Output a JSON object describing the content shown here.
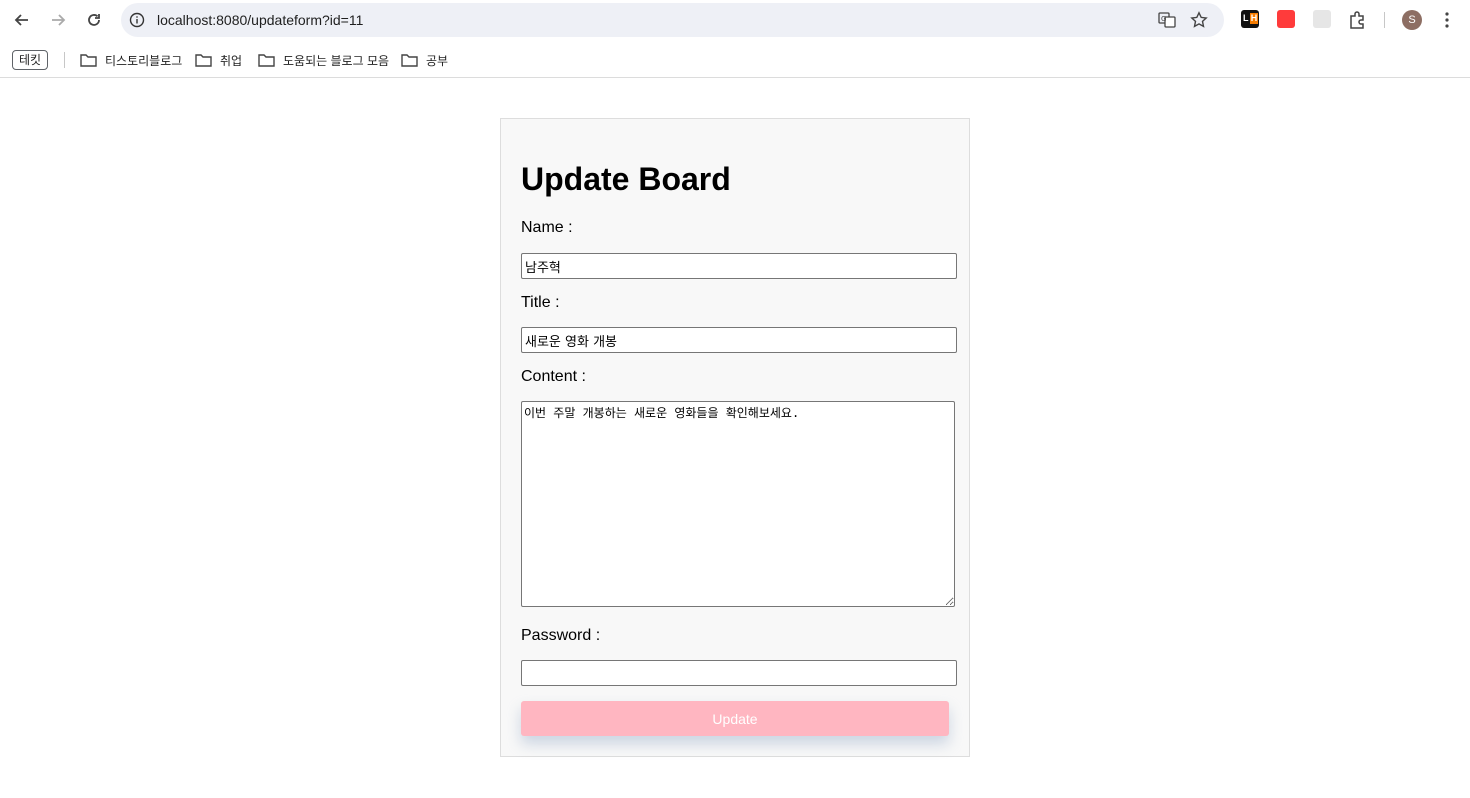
{
  "browser": {
    "url": "localhost:8080/updateform?id=11",
    "profile_initial": "S",
    "bookmarks": [
      {
        "label": "테킷"
      },
      {
        "label": "티스토리블로그"
      },
      {
        "label": "취업"
      },
      {
        "label": "도움되는 블로그 모음"
      },
      {
        "label": "공부"
      }
    ]
  },
  "form": {
    "title": "Update Board",
    "name_label": "Name :",
    "name_value": "남주혁",
    "title_label": "Title :",
    "title_value": "새로운 영화 개봉",
    "content_label": "Content :",
    "content_value": "이번 주말 개봉하는 새로운 영화들을 확인해보세요.",
    "password_label": "Password :",
    "password_value": "",
    "submit_label": "Update"
  },
  "colors": {
    "button_bg": "#ffb6c1",
    "card_bg": "#f8f8f8"
  }
}
